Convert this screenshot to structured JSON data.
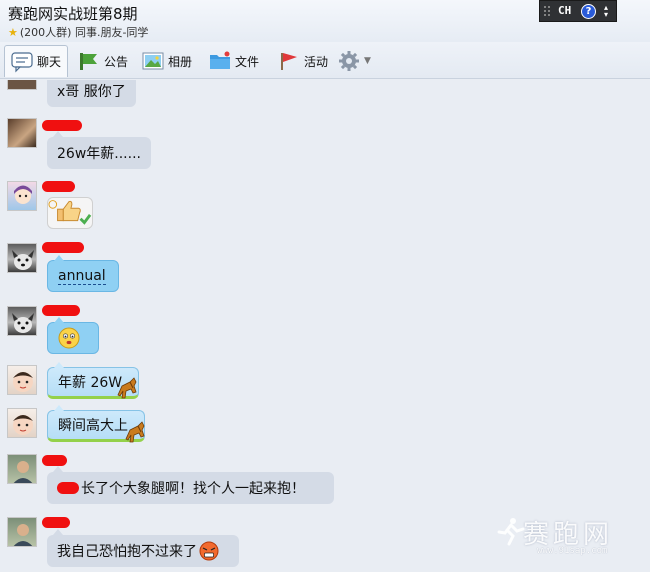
{
  "window": {
    "group_name": "赛跑网实战班第8期",
    "group_meta": "(200人群) 同事.朋友-同学",
    "lang_indicator": "CH",
    "help_label": "?"
  },
  "tabs": [
    {
      "label": "聊天",
      "icon": "chat-icon"
    },
    {
      "label": "公告",
      "icon": "announcement-icon"
    },
    {
      "label": "相册",
      "icon": "album-icon"
    },
    {
      "label": "文件",
      "icon": "folder-icon"
    },
    {
      "label": "活动",
      "icon": "flag-icon"
    },
    {
      "label": "",
      "icon": "gear-icon"
    }
  ],
  "messages": [
    {
      "text": "x哥  服你了",
      "sticker": ""
    },
    {
      "text": "26w年薪......",
      "sticker": ""
    },
    {
      "text": "",
      "sticker": "thumbs-up-sticker"
    },
    {
      "text": "annual",
      "sticker": ""
    },
    {
      "text": "",
      "sticker": "worried-face-emoji"
    },
    {
      "text": "年薪 26W",
      "sticker": "horse-sticker"
    },
    {
      "text": "瞬间高大上",
      "sticker": "horse-sticker"
    },
    {
      "text": "长了个大象腿啊！找个人一起来抱！",
      "sticker": ""
    },
    {
      "text": "我自己恐怕抱不过来了",
      "sticker": "angry-face-emoji"
    }
  ],
  "watermark": {
    "text": "赛跑网",
    "url": "www.91sap.com"
  },
  "colors": {
    "background": "#e9edf3",
    "bubble_gray": "#d4dbe6",
    "bubble_blue": "#8fd0f3",
    "bubble_green_border": "#94d14a",
    "redaction": "#f01010"
  }
}
